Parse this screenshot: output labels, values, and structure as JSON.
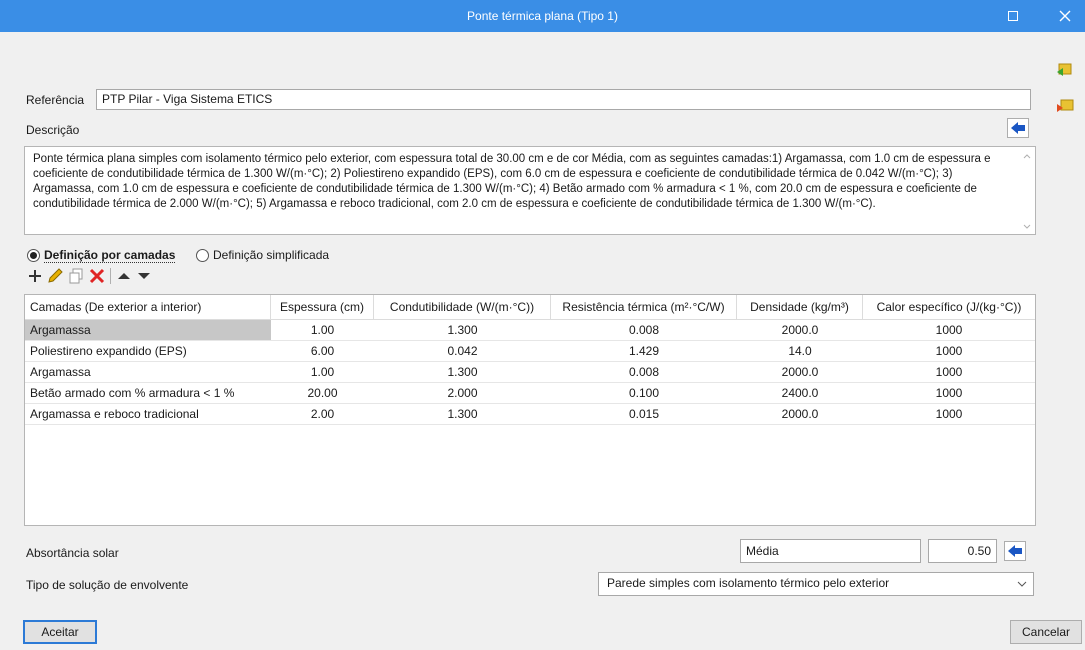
{
  "window": {
    "title": "Ponte térmica plana (Tipo 1)"
  },
  "referencia": {
    "label": "Referência",
    "value": "PTP Pilar - Viga Sistema ETICS"
  },
  "descricao": {
    "label": "Descrição",
    "text": "Ponte térmica plana simples com isolamento térmico pelo exterior, com espessura total de 30.00 cm e de cor Média, com as seguintes camadas:1) Argamassa, com 1.0 cm de espessura e coeficiente de condutibilidade térmica de 1.300 W/(m·°C); 2) Poliestireno expandido (EPS), com 6.0 cm de espessura e coeficiente de condutibilidade térmica de 0.042 W/(m·°C); 3) Argamassa, com 1.0 cm de espessura e coeficiente de condutibilidade térmica de 1.300 W/(m·°C); 4) Betão armado com % armadura < 1 %, com 20.0 cm de espessura e coeficiente de condutibilidade térmica de 2.000 W/(m·°C); 5) Argamassa e reboco tradicional, com 2.0 cm de espessura e coeficiente de condutibilidade térmica de 1.300 W/(m·°C)."
  },
  "definition": {
    "option1": "Definição por camadas",
    "option2": "Definição simplificada",
    "selected": "option1"
  },
  "table": {
    "columns": [
      "Camadas (De exterior a interior)",
      "Espessura (cm)",
      "Condutibilidade (W/(m·°C))",
      "Resistência térmica (m²·°C/W)",
      "Densidade (kg/m³)",
      "Calor específico (J/(kg·°C))"
    ],
    "rows": [
      [
        "Argamassa",
        "1.00",
        "1.300",
        "0.008",
        "2000.0",
        "1000"
      ],
      [
        "Poliestireno expandido (EPS)",
        "6.00",
        "0.042",
        "1.429",
        "14.0",
        "1000"
      ],
      [
        "Argamassa",
        "1.00",
        "1.300",
        "0.008",
        "2000.0",
        "1000"
      ],
      [
        "Betão armado com % armadura < 1 %",
        "20.00",
        "2.000",
        "0.100",
        "2400.0",
        "1000"
      ],
      [
        "Argamassa e reboco tradicional",
        "2.00",
        "1.300",
        "0.015",
        "2000.0",
        "1000"
      ]
    ]
  },
  "absortancia": {
    "label": "Absortância solar",
    "color_value": "Média",
    "numeric_value": "0.50"
  },
  "tipo_solucao": {
    "label": "Tipo de solução de envolvente",
    "value": "Parede simples com isolamento térmico pelo exterior"
  },
  "buttons": {
    "accept": "Aceitar",
    "cancel": "Cancelar"
  },
  "colors": {
    "titlebar": "#3a8ee6",
    "arrow": "#1a56c4",
    "delete": "#e02424",
    "pencil": "#e8b100"
  }
}
